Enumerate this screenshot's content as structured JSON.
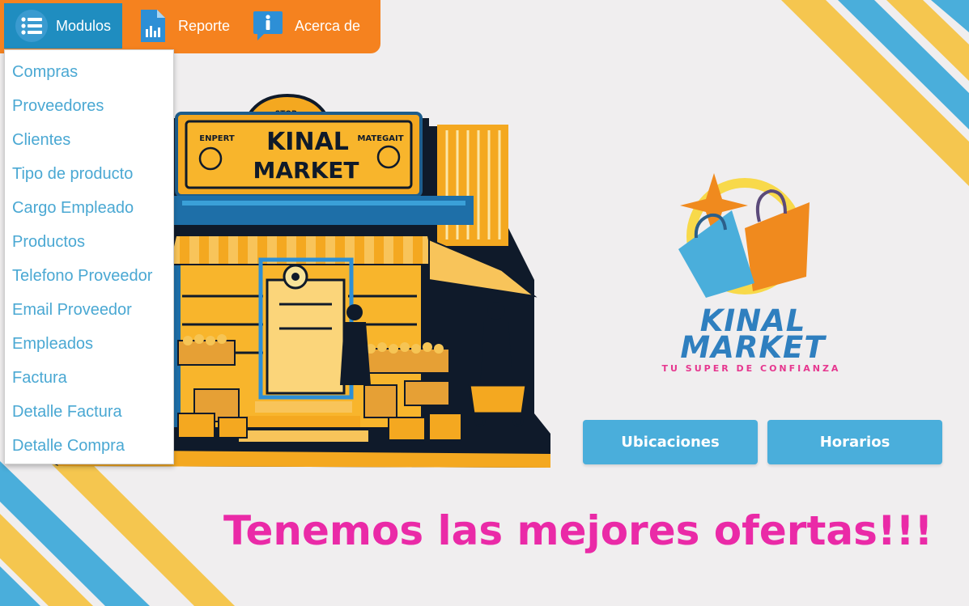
{
  "menubar": {
    "items": [
      {
        "label": "Modulos",
        "icon": "list-icon",
        "active": true
      },
      {
        "label": "Reporte",
        "icon": "report-document-icon",
        "active": false
      },
      {
        "label": "Acerca de",
        "icon": "info-icon",
        "active": false
      }
    ]
  },
  "dropdown": {
    "items": [
      "Compras",
      "Proveedores",
      "Clientes",
      "Tipo de producto",
      "Cargo Empleado",
      "Productos",
      "Telefono Proveedor",
      "Email Proveedor",
      "Empleados",
      "Factura",
      "Detalle Factura",
      "Detalle Compra"
    ]
  },
  "store_sign": {
    "top": "STOP:",
    "left": "ENPERT",
    "right": "MATEGAIT",
    "line1": "KINAL",
    "line2": "MARKET"
  },
  "logo": {
    "line1": "KINAL",
    "line2": "MARKET",
    "tagline": "TU SUPER DE CONFIANZA"
  },
  "buttons": {
    "ubicaciones": "Ubicaciones",
    "horarios": "Horarios"
  },
  "slogan": "Tenemos las mejores ofertas!!!",
  "colors": {
    "menubar": "#f5821f",
    "menu_active": "#1f8dc0",
    "link": "#4aa8d3",
    "button": "#4aaedb",
    "slogan": "#ea2aa7",
    "stripe_yellow": "#f5c64f",
    "stripe_blue": "#4aaedb"
  }
}
